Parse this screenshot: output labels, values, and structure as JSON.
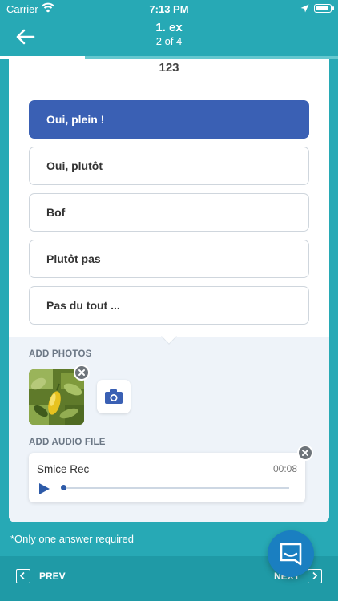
{
  "status_bar": {
    "carrier": "Carrier",
    "time": "7:13 PM"
  },
  "header": {
    "title": "1. ex",
    "subtitle": "2 of 4"
  },
  "progress": {
    "fraction": 0.25
  },
  "question": {
    "top_value": "123",
    "options": [
      {
        "label": "Oui, plein !",
        "selected": true
      },
      {
        "label": "Oui, plutôt",
        "selected": false
      },
      {
        "label": "Bof",
        "selected": false
      },
      {
        "label": "Plutôt pas",
        "selected": false
      },
      {
        "label": "Pas du tout ...",
        "selected": false
      }
    ]
  },
  "attachments": {
    "photos_label": "ADD PHOTOS",
    "audio_label": "ADD AUDIO FILE",
    "audio": {
      "name": "Smice Rec",
      "duration": "00:08",
      "position": 0
    }
  },
  "note": "*Only one answer required",
  "footer": {
    "prev_label": "PREV",
    "next_label": "NEXT"
  },
  "colors": {
    "teal": "#27a9b5",
    "selected": "#3a60b4",
    "chat": "#1a7fc1"
  }
}
